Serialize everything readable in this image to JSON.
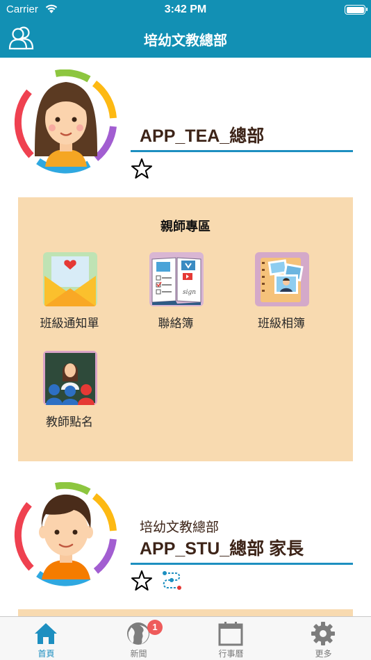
{
  "status_bar": {
    "carrier": "Carrier",
    "time": "3:42 PM"
  },
  "nav": {
    "title": "培幼文教總部"
  },
  "teacher_profile": {
    "name": "APP_TEA_總部",
    "favorite": false
  },
  "panel": {
    "title": "親師專區",
    "items": [
      {
        "label": "班級通知單",
        "icon": "notice-envelope-icon"
      },
      {
        "label": "聯絡簿",
        "icon": "contact-book-icon"
      },
      {
        "label": "班級相簿",
        "icon": "photo-album-icon"
      },
      {
        "label": "教師點名",
        "icon": "roll-call-icon"
      }
    ]
  },
  "student_profile": {
    "org": "培幼文教總部",
    "name": "APP_STU_總部 家長",
    "favorite": false
  },
  "tabbar": {
    "items": [
      {
        "label": "首頁",
        "icon": "home-icon",
        "active": true
      },
      {
        "label": "新聞",
        "icon": "globe-icon",
        "badge": "1"
      },
      {
        "label": "行事曆",
        "icon": "calendar-icon"
      },
      {
        "label": "更多",
        "icon": "gear-icon"
      }
    ]
  },
  "colors": {
    "header": "#1290b4",
    "panel": "#f8dab0",
    "accent": "#1d8fc0",
    "name_text": "#3d2418",
    "badge": "#ee5b5b"
  }
}
